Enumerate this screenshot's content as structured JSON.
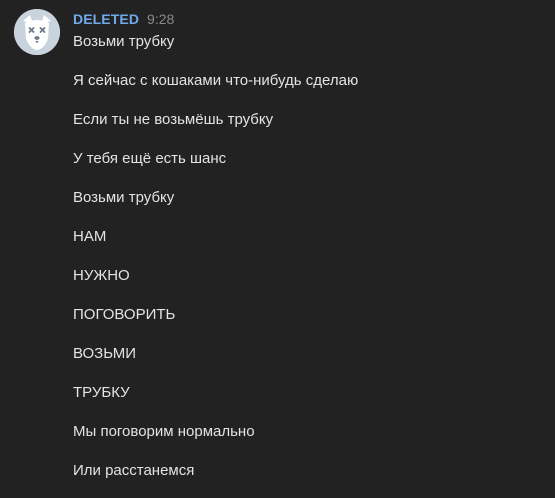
{
  "author": {
    "name": "DELETED",
    "time": "9:28",
    "avatar_icon": "deleted-user-dog-icon"
  },
  "colors": {
    "background": "#222222",
    "author_name": "#71aaeb",
    "text": "#e1e3e6",
    "time": "#8a8a8a",
    "avatar_bg": "#c9d3de"
  },
  "messages": [
    {
      "text": "Возьми трубку"
    },
    {
      "text": "Я сейчас с кошаками что-нибудь сделаю"
    },
    {
      "text": "Если ты не возьмёшь трубку"
    },
    {
      "text": "У тебя ещё есть шанс"
    },
    {
      "text": "Возьми трубку"
    },
    {
      "text": "НАМ"
    },
    {
      "text": "НУЖНО"
    },
    {
      "text": "ПОГОВОРИТЬ"
    },
    {
      "text": "ВОЗЬМИ"
    },
    {
      "text": "ТРУБКУ"
    },
    {
      "text": "Мы поговорим нормально"
    },
    {
      "text": "Или расстанемся"
    }
  ]
}
